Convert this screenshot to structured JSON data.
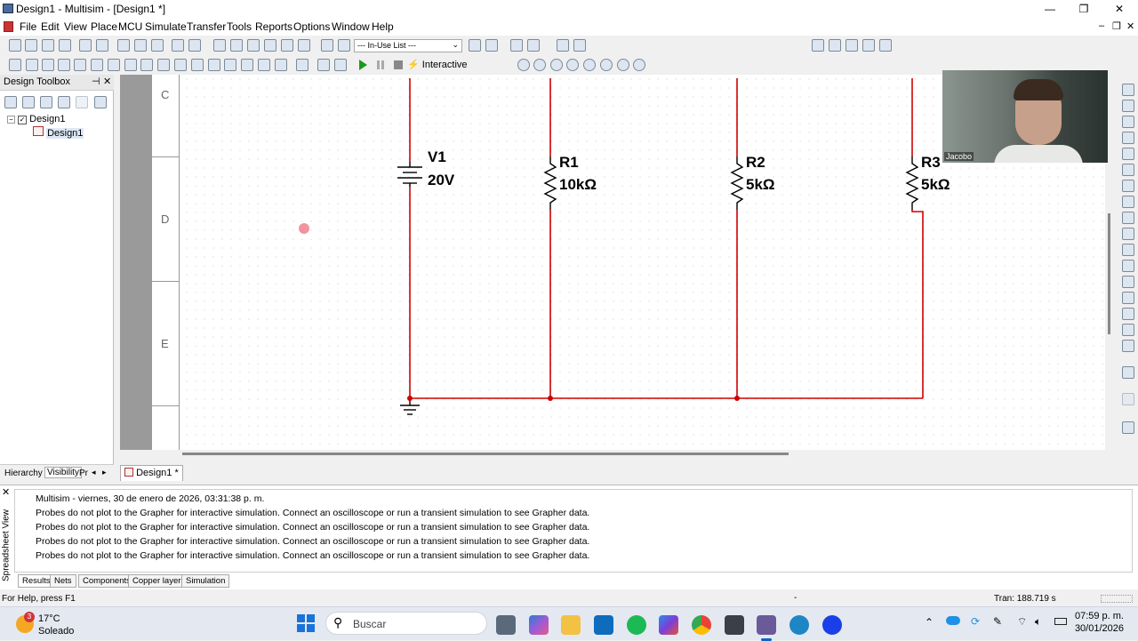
{
  "window": {
    "title": "Design1 - Multisim - [Design1 *]"
  },
  "menu": [
    "File",
    "Edit",
    "View",
    "Place",
    "MCU",
    "Simulate",
    "Transfer",
    "Tools",
    "Reports",
    "Options",
    "Window",
    "Help"
  ],
  "toolbar": {
    "in_use_list": "--- In-Use List ---",
    "interactive": "Interactive"
  },
  "toolbox": {
    "title": "Design Toolbox",
    "root": "Design1",
    "child": "Design1",
    "tabs": [
      "Hierarchy",
      "Visibility",
      "Pr"
    ]
  },
  "schematic": {
    "rows": [
      "C",
      "D",
      "E"
    ],
    "components": [
      {
        "ref": "V1",
        "value": "20V"
      },
      {
        "ref": "R1",
        "value": "10kΩ"
      },
      {
        "ref": "R2",
        "value": "5kΩ"
      },
      {
        "ref": "R3",
        "value": "5kΩ"
      }
    ],
    "wire_color": "#d00000",
    "sheet_tab": "Design1 *"
  },
  "webcam": {
    "name": "Jacobo"
  },
  "spreadsheet": {
    "side_label": "Spreadsheet View",
    "lines": [
      "Multisim  -  viernes, 30 de enero de 2026, 03:31:38 p. m.",
      "Probes do not plot to the Grapher for interactive simulation. Connect an oscilloscope or run a transient simulation to see Grapher data.",
      "Probes do not plot to the Grapher for interactive simulation. Connect an oscilloscope or run a transient simulation to see Grapher data.",
      "Probes do not plot to the Grapher for interactive simulation. Connect an oscilloscope or run a transient simulation to see Grapher data.",
      "Probes do not plot to the Grapher for interactive simulation. Connect an oscilloscope or run a transient simulation to see Grapher data."
    ],
    "tabs": [
      "Results",
      "Nets",
      "Components",
      "Copper layers",
      "Simulation"
    ]
  },
  "status": {
    "help": "For Help, press F1",
    "dash": "-",
    "tran": "Tran: 188.719 s"
  },
  "taskbar": {
    "weather_temp": "17°C",
    "weather_desc": "Soleado",
    "badge": "3",
    "search": "Buscar",
    "time": "07:59 p. m.",
    "date": "30/01/2026"
  }
}
